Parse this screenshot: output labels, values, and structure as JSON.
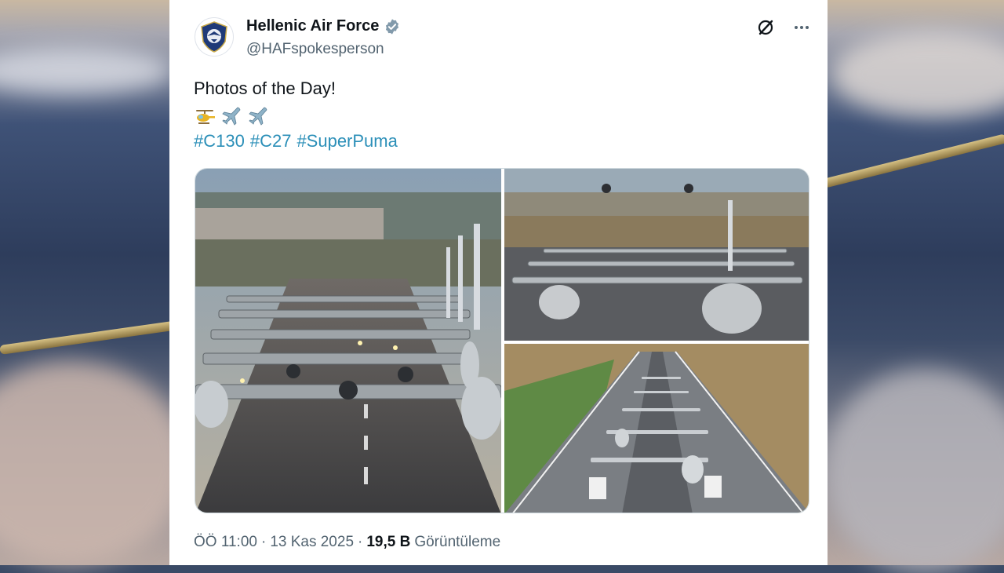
{
  "tweet": {
    "display_name": "Hellenic Air Force",
    "handle": "@HAFspokesperson",
    "text": "Photos of the Day!",
    "emojis": [
      "helicopter",
      "airplane",
      "airplane"
    ],
    "hashtags": [
      "#C130",
      "#C27",
      "#SuperPuma"
    ],
    "time": "ÖÖ 11:00",
    "separator1": "·",
    "date": "13 Kas 2025",
    "separator2": "·",
    "views_count": "19,5 B",
    "views_label": "Görüntüleme"
  },
  "media": {
    "photos": [
      {
        "name": "photo-1",
        "subject": "C-130 aircraft lined up on runway"
      },
      {
        "name": "photo-2",
        "subject": "aircraft taxiing with helicopters overhead"
      },
      {
        "name": "photo-3",
        "subject": "aerial view of aircraft formation on runway"
      }
    ]
  },
  "icons": {
    "verified": "verified-badge-icon",
    "grok": "grok-icon",
    "more": "more-icon"
  },
  "colors": {
    "hashtag": "#2b8fb8",
    "text_primary": "#0f1419",
    "text_secondary": "#536471"
  }
}
